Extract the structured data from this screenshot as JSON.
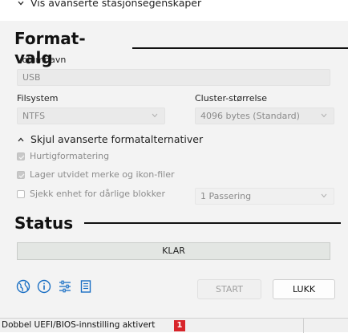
{
  "advanced_toggle": {
    "label": "Vis avanserte stasjonsegenskaper"
  },
  "format": {
    "heading": "Format-valg",
    "volume_label": {
      "label": "Volumnavn",
      "value": "USB"
    },
    "filesystem": {
      "label": "Filsystem",
      "value": "NTFS"
    },
    "cluster": {
      "label": "Cluster-størrelse",
      "value": "4096 bytes (Standard)"
    },
    "advanced_format_toggle": "Skjul avanserte formatalternativer",
    "options": [
      {
        "label": "Hurtigformatering",
        "checked": true
      },
      {
        "label": "Lager utvidet merke og ikon-filer",
        "checked": true
      },
      {
        "label": "Sjekk enhet for dårlige blokker",
        "checked": false
      }
    ],
    "passes": "1 Passering"
  },
  "status": {
    "heading": "Status",
    "text": "KLAR"
  },
  "toolbar_icons": [
    "globe-icon",
    "info-icon",
    "settings-sliders-icon",
    "log-icon"
  ],
  "buttons": {
    "start": "START",
    "close": "LUKK"
  },
  "footer": {
    "text": "Dobbel UEFI/BIOS-innstilling aktivert",
    "badge": "1"
  },
  "colors": {
    "accent_icon": "#1a6fc4",
    "badge": "#d8242a"
  }
}
